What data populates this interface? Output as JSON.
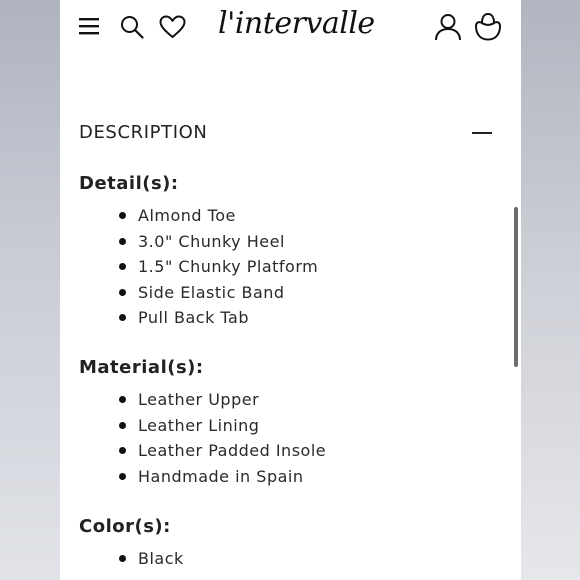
{
  "header": {
    "logo_text": "l'intervalle",
    "icons": [
      "menu-icon",
      "search-icon",
      "heart-icon",
      "user-icon",
      "bag-icon"
    ]
  },
  "description": {
    "title": "DESCRIPTION",
    "collapse_symbol": "minus"
  },
  "details": {
    "heading": "Detail(s):",
    "items": [
      "Almond Toe",
      "3.0\" Chunky Heel",
      "1.5\" Chunky Platform",
      "Side Elastic Band",
      "Pull Back Tab"
    ]
  },
  "materials": {
    "heading": "Material(s):",
    "items": [
      "Leather Upper",
      "Leather Lining",
      "Leather Padded Insole",
      "Handmade in Spain"
    ]
  },
  "colors": {
    "heading": "Color(s):",
    "items": [
      "Black"
    ]
  }
}
